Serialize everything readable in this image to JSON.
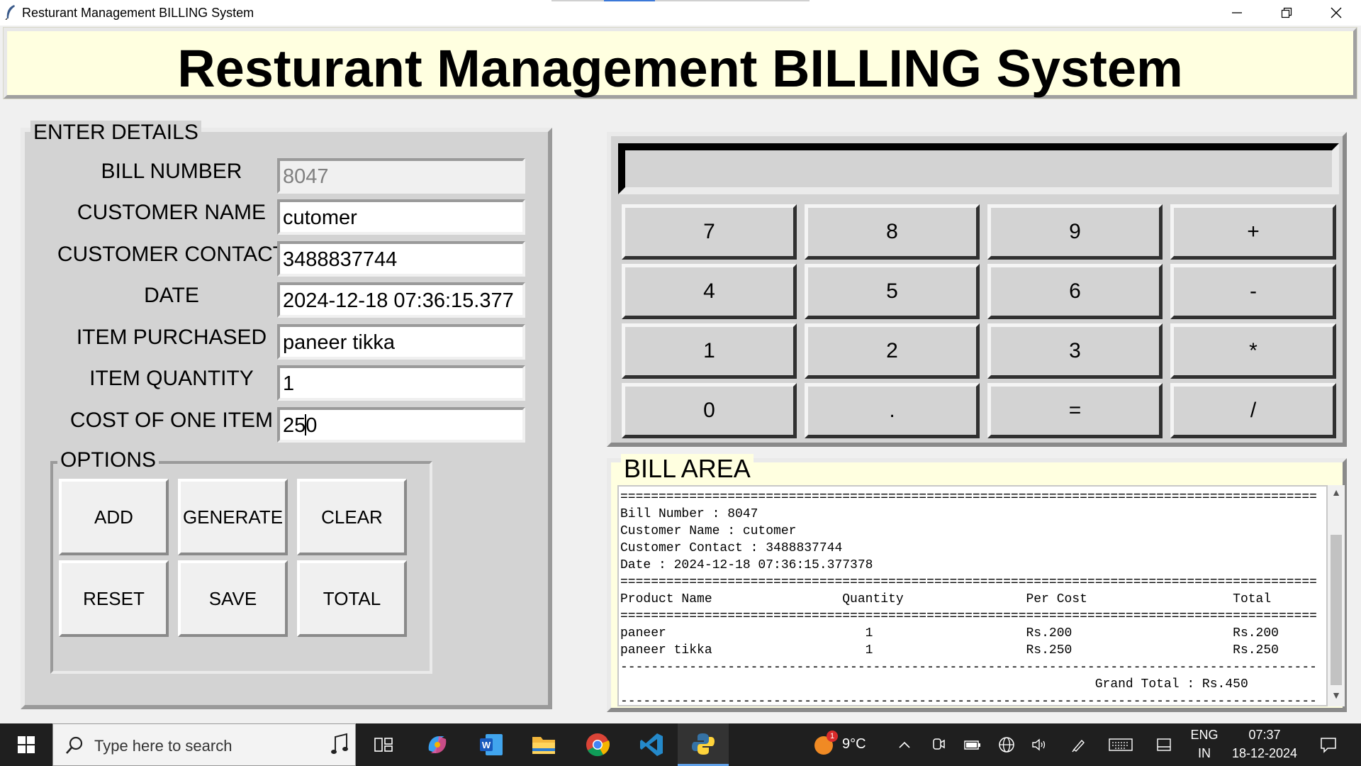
{
  "window": {
    "title": "Resturant Management BILLING System",
    "controls": [
      "minimize-icon",
      "restore-icon",
      "close-icon"
    ]
  },
  "header": {
    "title": "Resturant Management BILLING System"
  },
  "details": {
    "legend": "ENTER DETAILS",
    "fields": [
      {
        "label": "BILL NUMBER",
        "value": "8047",
        "disabled": true
      },
      {
        "label": "CUSTOMER NAME",
        "value": "cutomer"
      },
      {
        "label": "CUSTOMER CONTACT",
        "value": "3488837744"
      },
      {
        "label": "DATE",
        "value": "2024-12-18 07:36:15.377"
      },
      {
        "label": "ITEM PURCHASED",
        "value": "paneer tikka"
      },
      {
        "label": "ITEM QUANTITY",
        "value": "1"
      },
      {
        "label": "COST OF ONE ITEM",
        "value": "250",
        "value_before_cursor": "25",
        "value_after_cursor": "0"
      }
    ]
  },
  "options": {
    "legend": "OPTIONS",
    "buttons": [
      "ADD",
      "GENERATE",
      "CLEAR",
      "RESET",
      "SAVE",
      "TOTAL"
    ]
  },
  "calculator": {
    "display": "",
    "keys": [
      "7",
      "8",
      "9",
      "+",
      "4",
      "5",
      "6",
      "-",
      "1",
      "2",
      "3",
      "*",
      "0",
      ".",
      "=",
      "/"
    ]
  },
  "bill": {
    "legend": "BILL AREA",
    "text": "===========================================================================================\nBill Number : 8047\nCustomer Name : cutomer\nCustomer Contact : 3488837744\nDate : 2024-12-18 07:36:15.377378\n===========================================================================================\nProduct Name                 Quantity                Per Cost                   Total\n===========================================================================================\npaneer                          1                    Rs.200                     Rs.200\npaneer tikka                    1                    Rs.250                     Rs.250\n-------------------------------------------------------------------------------------------\n                                                              Grand Total : Rs.450\n-------------------------------------------------------------------------------------------"
  },
  "taskbar": {
    "search_placeholder": "Type here to search",
    "weather": {
      "temp": "9°C",
      "badge": "1"
    },
    "language": {
      "line1": "ENG",
      "line2": "IN"
    },
    "clock": {
      "time": "07:37",
      "date": "18-12-2024"
    },
    "apps": [
      "windows-start-icon",
      "search-icon",
      "task-view-icon",
      "copilot-icon",
      "word-icon",
      "file-explorer-icon",
      "chrome-icon",
      "vscode-icon",
      "python-icon"
    ],
    "tray": [
      "chevron-up-icon",
      "meet-icon",
      "battery-icon",
      "globe-icon",
      "volume-icon",
      "pen-icon",
      "keyboard-icon",
      "tablet-icon",
      "notifications-icon"
    ]
  }
}
